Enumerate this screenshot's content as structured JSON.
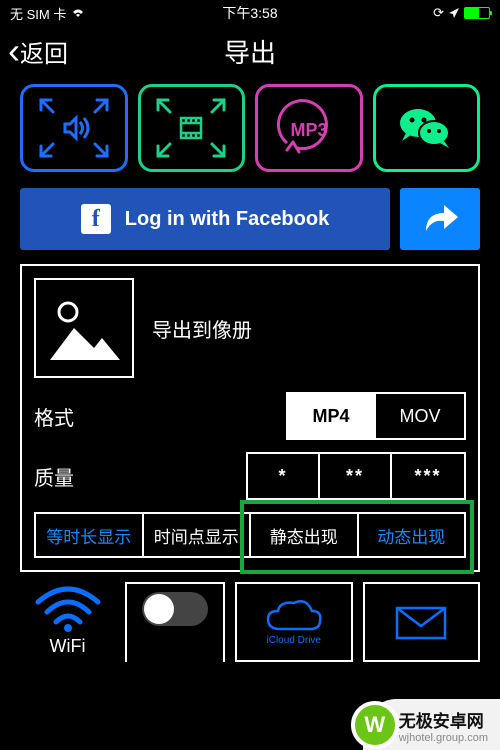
{
  "status": {
    "sim": "无 SIM 卡",
    "time": "下午3:58"
  },
  "nav": {
    "back_label": "返回",
    "title": "导出"
  },
  "tiles": {
    "mp3_label": "MP3"
  },
  "actions": {
    "facebook_label": "Log in with Facebook"
  },
  "panel": {
    "gallery_label": "导出到像册",
    "format_label": "格式",
    "format_options": {
      "mp4": "MP4",
      "mov": "MOV"
    },
    "quality_label": "质量",
    "quality_options": {
      "one": "*",
      "two": "**",
      "three": "***"
    },
    "tab1": "等时长显示",
    "tab2": "时间点显示",
    "tab3": "静态出现",
    "tab4": "动态出现"
  },
  "footer": {
    "wifi_label": "WiFi",
    "icloud_label": "iCloud Drive"
  },
  "watermark": {
    "line1": "无极安卓网",
    "line2": "wjhotel.group.com"
  }
}
